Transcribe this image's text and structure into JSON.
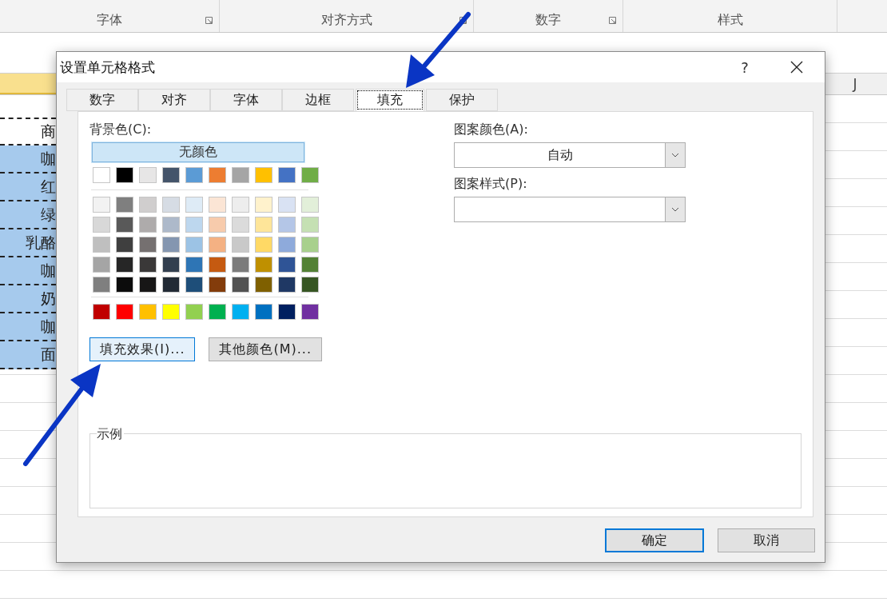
{
  "ribbon": {
    "groups": [
      {
        "label": "字体",
        "launcher": true
      },
      {
        "label": "对齐方式",
        "launcher": true
      },
      {
        "label": "数字",
        "launcher": true
      },
      {
        "label": "样式",
        "launcher": false
      }
    ]
  },
  "column_header": {
    "label": "J"
  },
  "cells": [
    {
      "text": "商",
      "selected": false
    },
    {
      "text": "咖",
      "selected": true
    },
    {
      "text": "红",
      "selected": true
    },
    {
      "text": "绿",
      "selected": true
    },
    {
      "text": "乳酪",
      "selected": true
    },
    {
      "text": "咖",
      "selected": true
    },
    {
      "text": "奶",
      "selected": true
    },
    {
      "text": "咖",
      "selected": true
    },
    {
      "text": "面",
      "selected": true
    }
  ],
  "dialog": {
    "title": "设置单元格格式",
    "help": "?",
    "tabs": [
      {
        "label": "数字",
        "selected": false
      },
      {
        "label": "对齐",
        "selected": false
      },
      {
        "label": "字体",
        "selected": false
      },
      {
        "label": "边框",
        "selected": false
      },
      {
        "label": "填充",
        "selected": true
      },
      {
        "label": "保护",
        "selected": false
      }
    ],
    "background_label": "背景色(C):",
    "no_color": "无颜色",
    "theme_row": [
      {
        "color": "#ffffff"
      },
      {
        "color": "#000000"
      },
      {
        "color": "#e7e6e6"
      },
      {
        "color": "#44546a"
      },
      {
        "color": "#5b9bd5"
      },
      {
        "color": "#ed7d31"
      },
      {
        "color": "#a5a5a5"
      },
      {
        "color": "#ffc000"
      },
      {
        "color": "#4472c4"
      },
      {
        "color": "#70ad47"
      }
    ],
    "tint_rows": [
      [
        {
          "color": "#f2f2f2"
        },
        {
          "color": "#7f7f7f"
        },
        {
          "color": "#d0cece"
        },
        {
          "color": "#d6dce4"
        },
        {
          "color": "#deebf6"
        },
        {
          "color": "#fbe5d5"
        },
        {
          "color": "#ededed"
        },
        {
          "color": "#fff2cc"
        },
        {
          "color": "#d9e2f3"
        },
        {
          "color": "#e2efd9"
        }
      ],
      [
        {
          "color": "#d8d8d8"
        },
        {
          "color": "#595959"
        },
        {
          "color": "#aeabab"
        },
        {
          "color": "#adb9ca"
        },
        {
          "color": "#bdd7ee"
        },
        {
          "color": "#f7cbac"
        },
        {
          "color": "#dbdbdb"
        },
        {
          "color": "#fee599"
        },
        {
          "color": "#b4c6e7"
        },
        {
          "color": "#c5e0b3"
        }
      ],
      [
        {
          "color": "#bfbfbf"
        },
        {
          "color": "#3f3f3f"
        },
        {
          "color": "#757070"
        },
        {
          "color": "#8496b0"
        },
        {
          "color": "#9cc3e5"
        },
        {
          "color": "#f4b183"
        },
        {
          "color": "#c9c9c9"
        },
        {
          "color": "#ffd965"
        },
        {
          "color": "#8eaadb"
        },
        {
          "color": "#a8d08d"
        }
      ],
      [
        {
          "color": "#a5a5a5"
        },
        {
          "color": "#262626"
        },
        {
          "color": "#3a3838"
        },
        {
          "color": "#323f4f"
        },
        {
          "color": "#2e75b5"
        },
        {
          "color": "#c55a11"
        },
        {
          "color": "#7b7b7b"
        },
        {
          "color": "#bf9000"
        },
        {
          "color": "#2f5496"
        },
        {
          "color": "#538135"
        }
      ],
      [
        {
          "color": "#7f7f7f"
        },
        {
          "color": "#0c0c0c"
        },
        {
          "color": "#171616"
        },
        {
          "color": "#222a35"
        },
        {
          "color": "#1e4e79"
        },
        {
          "color": "#833c0b"
        },
        {
          "color": "#525252"
        },
        {
          "color": "#7f6000"
        },
        {
          "color": "#1f3864"
        },
        {
          "color": "#375623"
        }
      ]
    ],
    "standard_row": [
      {
        "color": "#c00000"
      },
      {
        "color": "#ff0000"
      },
      {
        "color": "#ffc000"
      },
      {
        "color": "#ffff00"
      },
      {
        "color": "#92d050"
      },
      {
        "color": "#00b050"
      },
      {
        "color": "#00b0f0"
      },
      {
        "color": "#0070c0"
      },
      {
        "color": "#002060"
      },
      {
        "color": "#7030a0"
      }
    ],
    "fill_effects_button": "填充效果(I)...",
    "more_colors_button": "其他颜色(M)...",
    "pattern_color_label": "图案颜色(A):",
    "pattern_color_value": "自动",
    "pattern_style_label": "图案样式(P):",
    "sample_label": "示例",
    "ok_button": "确定",
    "cancel_button": "取消"
  }
}
